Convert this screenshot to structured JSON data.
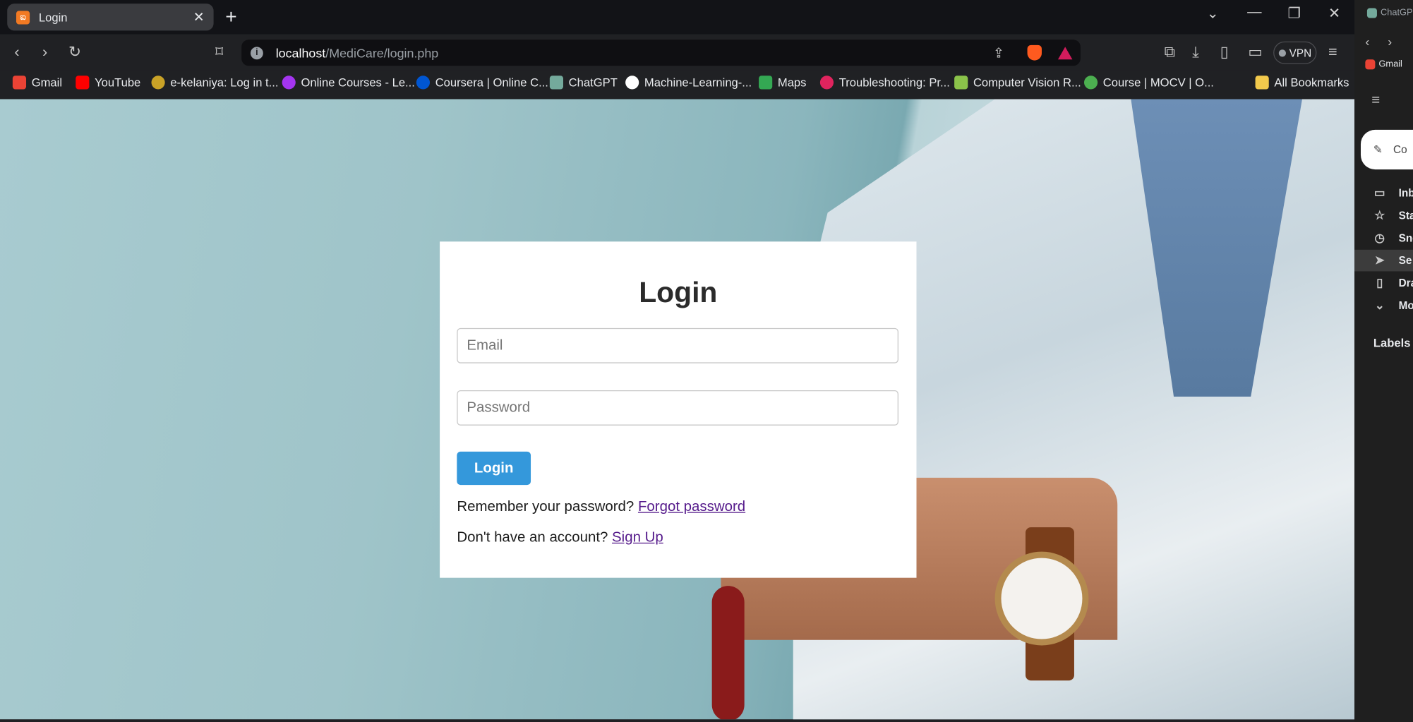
{
  "browser": {
    "tab": {
      "title": "Login",
      "favicon": "xampp-icon"
    },
    "url": {
      "host": "localhost",
      "path": "/MediCare/login.php"
    },
    "vpn_label": "VPN",
    "bookmarks": [
      {
        "label": "Gmail",
        "icon": "gmail-icon",
        "color": "#ea4335"
      },
      {
        "label": "YouTube",
        "icon": "youtube-icon",
        "color": "#ff0000"
      },
      {
        "label": "e-kelaniya: Log in t...",
        "icon": "kelaniya-icon",
        "color": "#c9a227"
      },
      {
        "label": "Online Courses - Le...",
        "icon": "udemy-icon",
        "color": "#a435f0"
      },
      {
        "label": "Coursera | Online C...",
        "icon": "coursera-icon",
        "color": "#0056d2"
      },
      {
        "label": "ChatGPT",
        "icon": "chatgpt-icon",
        "color": "#74aa9c"
      },
      {
        "label": "Machine-Learning-...",
        "icon": "github-icon",
        "color": "#ffffff"
      },
      {
        "label": "Maps",
        "icon": "maps-icon",
        "color": "#34a853"
      },
      {
        "label": "Troubleshooting: Pr...",
        "icon": "troubleshoot-icon",
        "color": "#e0245e"
      },
      {
        "label": "Computer Vision R...",
        "icon": "cv-icon",
        "color": "#8bc34a"
      },
      {
        "label": "Course | MOCV | O...",
        "icon": "mocv-icon",
        "color": "#4caf50"
      }
    ],
    "all_bookmarks": "All Bookmarks"
  },
  "login": {
    "title": "Login",
    "email_placeholder": "Email",
    "password_placeholder": "Password",
    "button": "Login",
    "remember_text": "Remember your password?",
    "forgot_link": "Forgot password",
    "no_account_text": "Don't have an account?",
    "signup_link": "Sign Up"
  },
  "side_panel": {
    "tab_label": "ChatGP",
    "gmail_label": "Gmail",
    "compose_label": "Co",
    "items": [
      "Inb",
      "Sta",
      "Sno",
      "Se",
      "Dra",
      "Mo"
    ],
    "labels_heading": "Labels"
  },
  "colors": {
    "accent": "#3498db",
    "link": "#551a8b",
    "card_bg": "#ffffff"
  }
}
